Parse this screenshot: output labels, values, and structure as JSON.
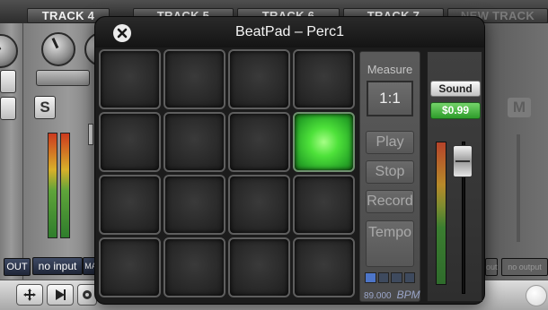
{
  "mixer": {
    "tracks": [
      "TRACK 4",
      "TRACK 5",
      "TRACK 6",
      "TRACK 7",
      "NEW TRACK"
    ],
    "solo_label": "S",
    "mute_label": "M",
    "io": {
      "out_label": "OUT",
      "input_label": "no input",
      "ma_label": "MA",
      "out_right": "out",
      "no_output": "no output"
    },
    "tools": {
      "move_icon": "move-arrows-icon",
      "play_icon": "play-icon",
      "settings_icon": "gear-icon"
    }
  },
  "beatpad": {
    "title": "BeatPad – Perc1",
    "close_icon": "close-circle-icon",
    "pads": {
      "rows": 4,
      "cols": 4,
      "lit": [
        [
          1,
          3
        ]
      ]
    },
    "controls": {
      "measure_label": "Measure",
      "measure_value": "1:1",
      "play_label": "Play",
      "stop_label": "Stop",
      "record_label": "Record",
      "tempo_label": "Tempo",
      "tempo_level_fraction": 0.25,
      "bpm_value": "89.000",
      "bpm_unit": "BPM"
    },
    "sound": {
      "button_label": "Sound",
      "price_label": "$0.99"
    }
  },
  "colors": {
    "pad_lit": "#4ee23a",
    "price_green": "#2e9c2a",
    "tempo_blue": "#4d75c8"
  }
}
